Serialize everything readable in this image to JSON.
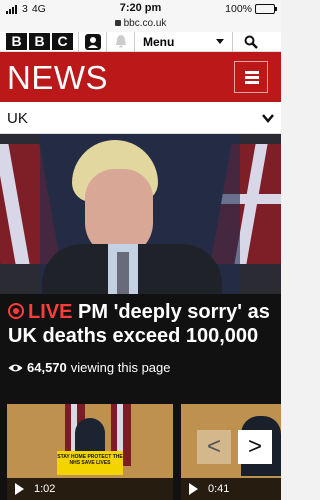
{
  "status_bar": {
    "carrier": "3",
    "network": "4G",
    "time": "7:20 pm",
    "battery": "100%",
    "url": "bbc.co.uk"
  },
  "bbc_header": {
    "logo_letters": [
      "B",
      "B",
      "C"
    ],
    "menu_label": "Menu",
    "icons": [
      "account-icon",
      "notification-bell-icon",
      "chevron-down-icon",
      "search-icon"
    ]
  },
  "news_bar": {
    "title": "NEWS",
    "icon": "hamburger-menu-icon",
    "color": "#bb1919"
  },
  "section_nav": {
    "label": "UK",
    "icon": "chevron-down-icon"
  },
  "live_story": {
    "live_label": "LIVE",
    "headline": "PM 'deeply sorry' as UK deaths exceed 100,000",
    "viewer_count": "64,570",
    "viewer_suffix": "viewing this page",
    "live_color": "#ff3b3b"
  },
  "video_cards": [
    {
      "duration": "1:02",
      "podium_text": "STAY HOME PROTECT THE NHS SAVE LIVES"
    },
    {
      "duration": "0:41"
    }
  ],
  "carousel": {
    "prev_symbol": "<",
    "next_symbol": ">"
  }
}
